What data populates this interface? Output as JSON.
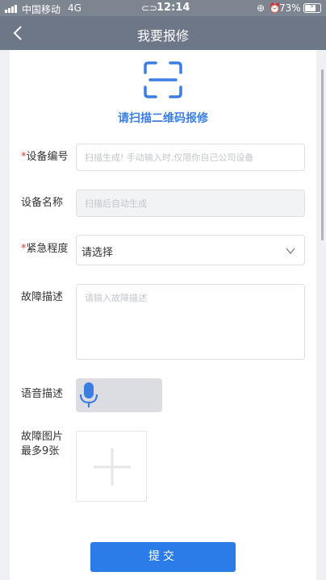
{
  "status_bar": {
    "carrier": "中国移动",
    "network": "4G",
    "time": "12:14",
    "battery_percent": "73%",
    "battery_level": 0.73
  },
  "header": {
    "title": "我要报修"
  },
  "scan": {
    "label": "请扫描二维码报修",
    "icon": "scan-frame-icon",
    "color": "#3b7de0"
  },
  "form": {
    "device_no": {
      "required_mark": "*",
      "label": "设备编号",
      "placeholder": "扫描生成! 手动输入时,仅限你自己公司设备"
    },
    "device_name": {
      "label": "设备名称",
      "placeholder": "扫描后自动生成"
    },
    "urgency": {
      "required_mark": "*",
      "label": "紧急程度",
      "value": "请选择"
    },
    "fault_desc": {
      "label": "故障描述",
      "placeholder": "请输入故障描述"
    },
    "voice_desc": {
      "label": "语音描述",
      "icon": "microphone-icon"
    },
    "images": {
      "label_line1": "故障图片",
      "label_line2": "最多9张",
      "icon": "plus-icon"
    }
  },
  "submit": {
    "label": "提交",
    "color": "#2b7ce9"
  }
}
